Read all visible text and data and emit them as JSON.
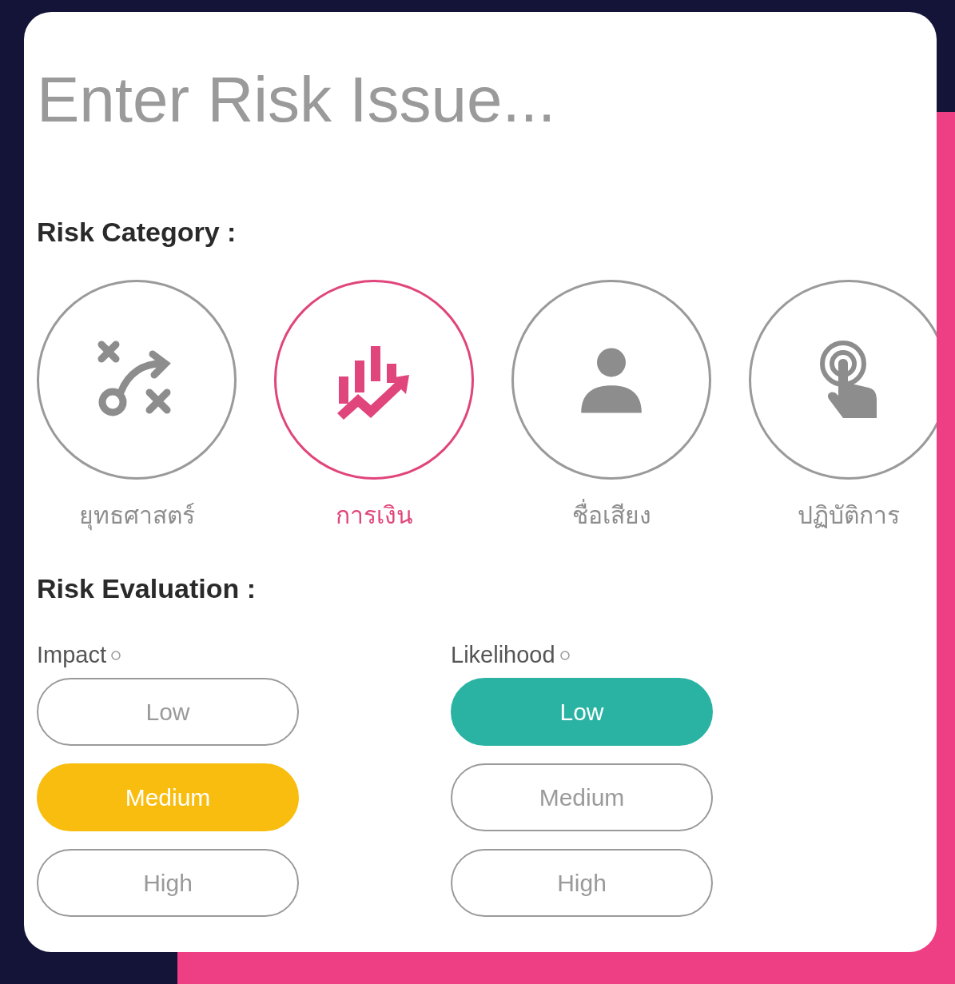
{
  "issue_field": {
    "placeholder": "Enter Risk Issue..."
  },
  "category": {
    "heading": "Risk Category :",
    "items": [
      {
        "kind": "strategy",
        "label": "ยุทธศาสตร์",
        "selected": false
      },
      {
        "kind": "finance",
        "label": "การเงิน",
        "selected": true
      },
      {
        "kind": "reputation",
        "label": "ชื่อเสียง",
        "selected": false
      },
      {
        "kind": "operations",
        "label": "ปฏิบัติการ",
        "selected": false
      }
    ]
  },
  "evaluation": {
    "heading": "Risk Evaluation :",
    "groups": [
      {
        "label": "Impact",
        "color": "#f8bd0e",
        "options": [
          {
            "label": "Low",
            "selected": false
          },
          {
            "label": "Medium",
            "selected": true
          },
          {
            "label": "High",
            "selected": false
          }
        ]
      },
      {
        "label": "Likelihood",
        "color": "#2ab3a3",
        "options": [
          {
            "label": "Low",
            "selected": true
          },
          {
            "label": "Medium",
            "selected": false
          },
          {
            "label": "High",
            "selected": false
          }
        ]
      }
    ]
  }
}
